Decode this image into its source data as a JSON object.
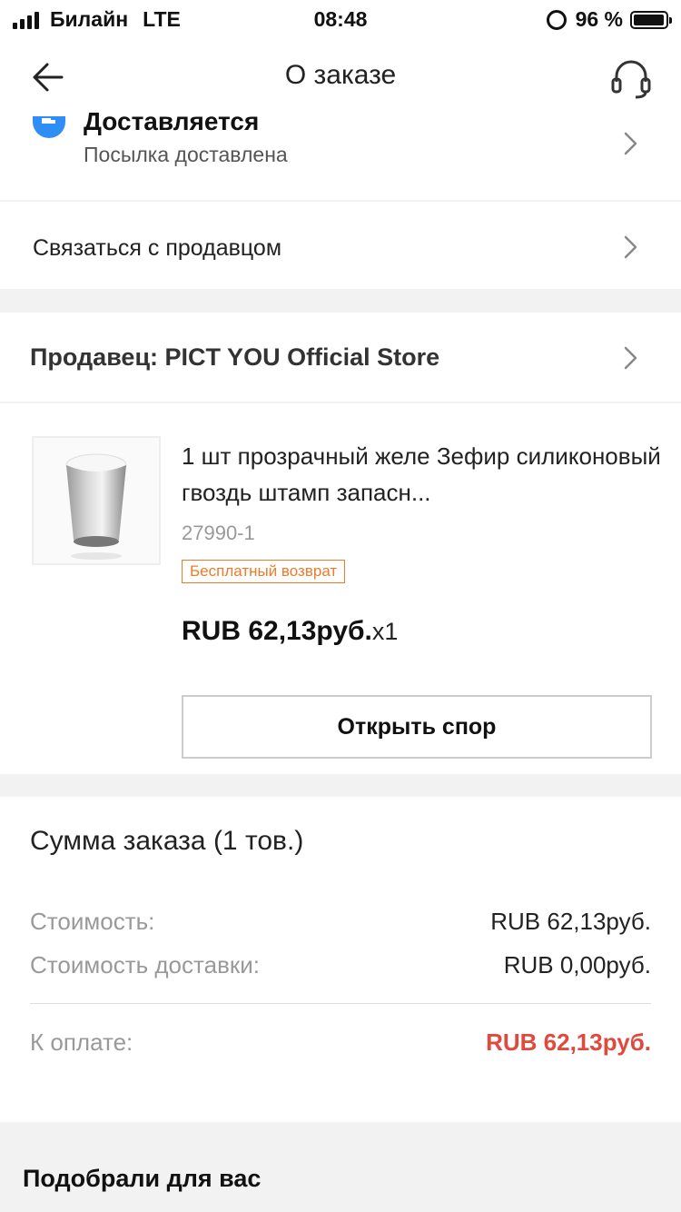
{
  "status_bar": {
    "carrier": "Билайн",
    "network": "LTE",
    "time": "08:48",
    "battery": "96 %",
    "battery_level": 0.96
  },
  "navbar": {
    "title": "О заказе",
    "back_icon": "arrow-left-icon",
    "support_icon": "headset-icon"
  },
  "delivery": {
    "status": "Доставляется",
    "substatus": "Посылка доставлена",
    "icon": "truck-icon",
    "icon_color": "#2f8ef5"
  },
  "contact_seller": {
    "label": "Связаться с продавцом"
  },
  "seller": {
    "label": "Продавец: PICT YOU Official Store"
  },
  "product": {
    "title": "1 шт прозрачный желе Зефир силиконовый гвоздь штамп запасн...",
    "sku": "27990-1",
    "badge": "Бесплатный возврат",
    "price": "RUB 62,13руб.",
    "quantity": "x1",
    "dispute_button": "Открыть спор",
    "badge_color": "#f07a2a"
  },
  "summary": {
    "title": "Сумма заказа (1 тов.)",
    "cost_label": "Стоимость:",
    "cost_value": "RUB 62,13руб.",
    "shipping_label": "Стоимость доставки:",
    "shipping_value": "RUB 0,00руб.",
    "total_label": "К оплате:",
    "total_value": "RUB 62,13руб.",
    "total_color": "#e04a3c"
  },
  "recommendations": {
    "title": "Подобрали для вас"
  }
}
